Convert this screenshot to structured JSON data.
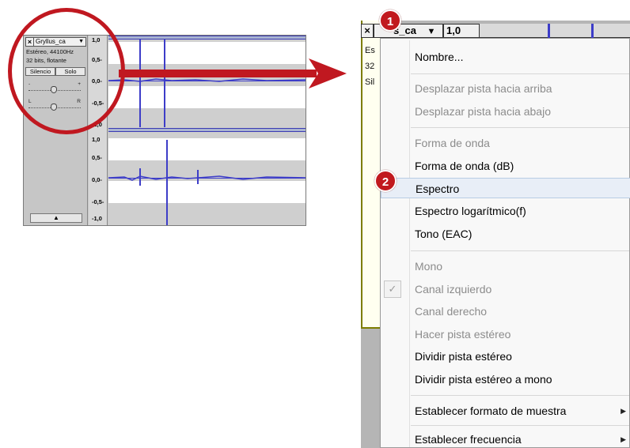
{
  "left_track": {
    "close_label": "×",
    "name": "Gryllus_ca",
    "name_arrow": "▼",
    "info_line1": "Estéreo, 44100Hz",
    "info_line2": "32 bits, flotante",
    "mute_label": "Silencio",
    "solo_label": "Solo",
    "gain_minus": "-",
    "gain_plus": "+",
    "pan_left": "L",
    "pan_right": "R",
    "collapse_label": "▲",
    "ruler_ticks": [
      "1,0",
      "0,5-",
      "0,0-",
      "-0,5-",
      "-1,0",
      "1,0",
      "0,5-",
      "0,0-",
      "-0,5-",
      "-1,0"
    ]
  },
  "right_header": {
    "close_label": "×",
    "name_fragment": "s_ca",
    "name_arrow": "▼",
    "value": "1,0",
    "left_fragments": [
      "Es",
      "32",
      "Sil"
    ]
  },
  "badges": {
    "one": "1",
    "two": "2"
  },
  "menu": {
    "items": [
      {
        "label": "Nombre...",
        "enabled": true
      },
      {
        "label": "Desplazar pista hacia arriba",
        "enabled": false
      },
      {
        "label": "Desplazar pista hacia abajo",
        "enabled": false
      },
      {
        "label": "Forma de onda",
        "enabled": false
      },
      {
        "label": "Forma de onda (dB)",
        "enabled": true
      },
      {
        "label": "Espectro",
        "enabled": true,
        "highlighted": true
      },
      {
        "label": "Espectro logarítmico(f)",
        "enabled": true
      },
      {
        "label": "Tono (EAC)",
        "enabled": true
      },
      {
        "label": "Mono",
        "enabled": false
      },
      {
        "label": "Canal izquierdo",
        "enabled": false,
        "checked": true
      },
      {
        "label": "Canal derecho",
        "enabled": false
      },
      {
        "label": "Hacer pista estéreo",
        "enabled": false
      },
      {
        "label": "Dividir pista estéreo",
        "enabled": true
      },
      {
        "label": "Dividir pista estéreo a mono",
        "enabled": true
      },
      {
        "label": "Establecer formato de muestra",
        "enabled": true,
        "submenu": "▶"
      },
      {
        "label": "Establecer frecuencia",
        "enabled": true,
        "submenu": "▶"
      }
    ],
    "check_mark": "✓"
  },
  "colors": {
    "accent_red": "#c01820",
    "wave_blue": "#3d3dc8",
    "hover_bg": "#e8eef7"
  }
}
